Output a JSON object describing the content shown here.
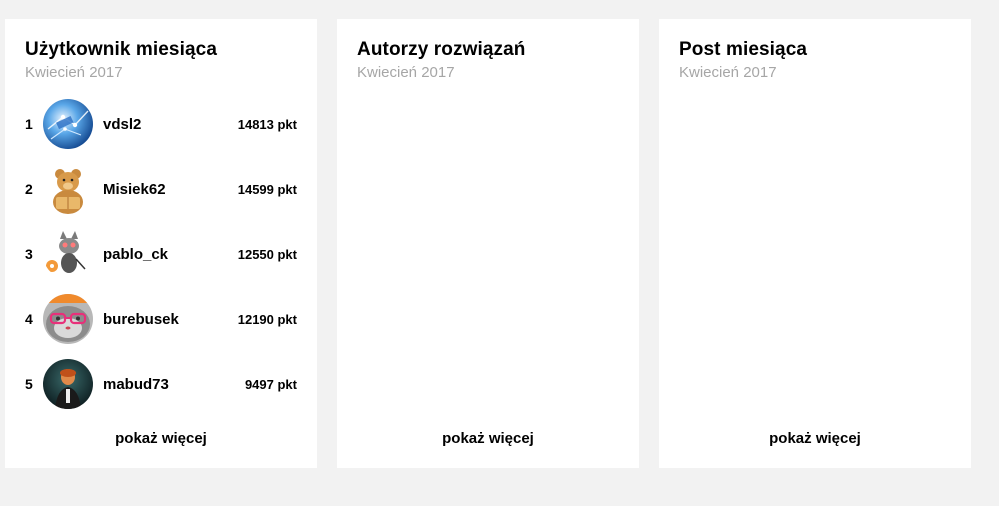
{
  "user_of_month": {
    "title": "Użytkownik miesiąca",
    "period": "Kwiecień 2017",
    "users": [
      {
        "rank": "1",
        "name": "vdsl2",
        "points": "14813 pkt",
        "avatar_icon": "network-globe-avatar"
      },
      {
        "rank": "2",
        "name": "Misiek62",
        "points": "14599 pkt",
        "avatar_icon": "teddy-bear-avatar"
      },
      {
        "rank": "3",
        "name": "pablo_ck",
        "points": "12550 pkt",
        "avatar_icon": "cartoon-cat-avatar"
      },
      {
        "rank": "4",
        "name": "burebusek",
        "points": "12190 pkt",
        "avatar_icon": "cat-glasses-avatar"
      },
      {
        "rank": "5",
        "name": "mabud73",
        "points": "9497 pkt",
        "avatar_icon": "dark-figure-avatar"
      }
    ],
    "more_label": "pokaż więcej"
  },
  "solution_authors": {
    "title": "Autorzy rozwiązań",
    "period": "Kwiecień 2017",
    "more_label": "pokaż więcej"
  },
  "post_of_month": {
    "title": "Post miesiąca",
    "period": "Kwiecień 2017",
    "more_label": "pokaż więcej"
  },
  "colors": {
    "background": "#f2f2f2",
    "card": "#ffffff",
    "muted_text": "#a6a6a6",
    "text": "#000000"
  }
}
